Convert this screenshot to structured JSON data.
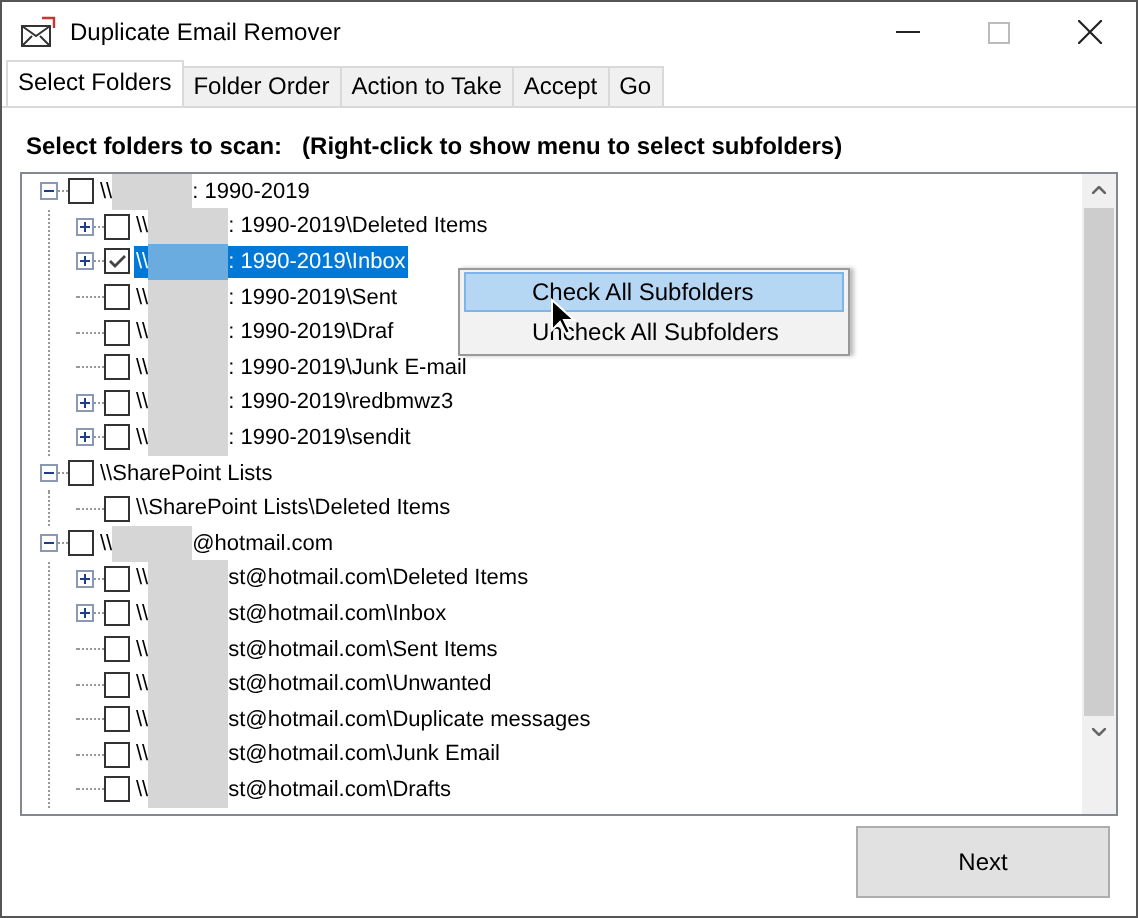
{
  "window": {
    "title": "Duplicate Email Remover"
  },
  "tabs": [
    {
      "label": "Select Folders",
      "selected": true
    },
    {
      "label": "Folder Order",
      "selected": false
    },
    {
      "label": "Action to Take",
      "selected": false
    },
    {
      "label": "Accept",
      "selected": false
    },
    {
      "label": "Go",
      "selected": false
    }
  ],
  "instruction": "Select folders to scan:   (Right-click to show menu to select subfolders)",
  "tree": [
    {
      "prefix": "\\\\",
      "suffix": ": 1990-2019",
      "redacted": true,
      "expandable": true,
      "expanded": true,
      "checked": false,
      "selected": false,
      "children": [
        {
          "prefix": "\\\\",
          "suffix": ": 1990-2019\\Deleted Items",
          "redacted": true,
          "expandable": true,
          "expanded": false,
          "checked": false,
          "selected": false
        },
        {
          "prefix": "\\\\",
          "suffix": ": 1990-2019\\Inbox",
          "redacted": true,
          "expandable": true,
          "expanded": false,
          "checked": true,
          "selected": true
        },
        {
          "prefix": "\\\\",
          "suffix": ": 1990-2019\\Sent",
          "redacted": true,
          "expandable": false,
          "checked": false,
          "selected": false
        },
        {
          "prefix": "\\\\",
          "suffix": ": 1990-2019\\Draf",
          "redacted": true,
          "expandable": false,
          "checked": false,
          "selected": false
        },
        {
          "prefix": "\\\\",
          "suffix": ": 1990-2019\\Junk E-mail",
          "redacted": true,
          "expandable": false,
          "checked": false,
          "selected": false
        },
        {
          "prefix": "\\\\",
          "suffix": ": 1990-2019\\redbmwz3",
          "redacted": true,
          "expandable": true,
          "expanded": false,
          "checked": false,
          "selected": false
        },
        {
          "prefix": "\\\\",
          "suffix": ": 1990-2019\\sendit",
          "redacted": true,
          "expandable": true,
          "expanded": false,
          "checked": false,
          "selected": false
        }
      ]
    },
    {
      "prefix": "\\\\SharePoint Lists",
      "redacted": false,
      "expandable": true,
      "expanded": true,
      "checked": false,
      "selected": false,
      "children": [
        {
          "prefix": "\\\\SharePoint Lists\\Deleted Items",
          "redacted": false,
          "expandable": false,
          "checked": false,
          "selected": false
        }
      ]
    },
    {
      "prefix": "\\\\",
      "suffix": "@hotmail.com",
      "redacted": true,
      "expandable": true,
      "expanded": true,
      "checked": false,
      "selected": false,
      "children": [
        {
          "prefix": "\\\\",
          "suffix": "st@hotmail.com\\Deleted Items",
          "redacted": true,
          "expandable": true,
          "expanded": false,
          "checked": false,
          "selected": false
        },
        {
          "prefix": "\\\\",
          "suffix": "st@hotmail.com\\Inbox",
          "redacted": true,
          "expandable": true,
          "expanded": false,
          "checked": false,
          "selected": false
        },
        {
          "prefix": "\\\\",
          "suffix": "st@hotmail.com\\Sent Items",
          "redacted": true,
          "expandable": false,
          "checked": false,
          "selected": false
        },
        {
          "prefix": "\\\\",
          "suffix": "st@hotmail.com\\Unwanted",
          "redacted": true,
          "expandable": false,
          "checked": false,
          "selected": false
        },
        {
          "prefix": "\\\\",
          "suffix": "st@hotmail.com\\Duplicate messages",
          "redacted": true,
          "expandable": false,
          "checked": false,
          "selected": false
        },
        {
          "prefix": "\\\\",
          "suffix": "st@hotmail.com\\Junk Email",
          "redacted": true,
          "expandable": false,
          "checked": false,
          "selected": false
        },
        {
          "prefix": "\\\\",
          "suffix": "st@hotmail.com\\Drafts",
          "redacted": true,
          "expandable": false,
          "checked": false,
          "selected": false
        }
      ]
    }
  ],
  "context_menu": [
    {
      "label": "Check All Subfolders",
      "selected": true
    },
    {
      "label": "Uncheck All Subfolders",
      "selected": false
    }
  ],
  "buttons": {
    "next": "Next"
  }
}
